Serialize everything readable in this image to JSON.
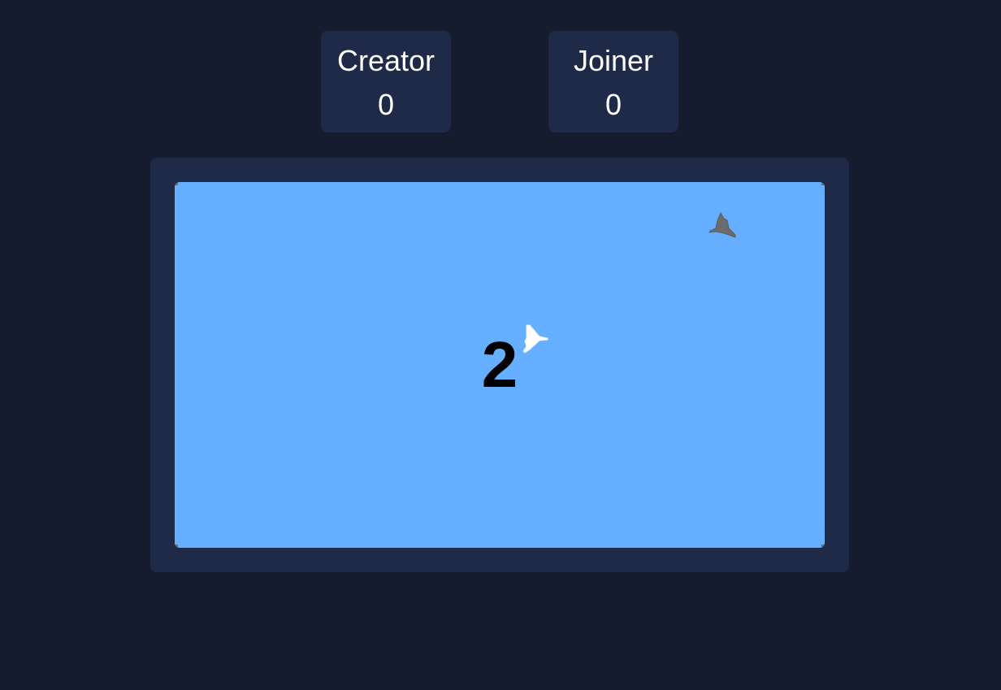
{
  "scoreboard": {
    "creator": {
      "label": "Creator",
      "score": "0"
    },
    "joiner": {
      "label": "Joiner",
      "score": "0"
    }
  },
  "arena": {
    "countdown": "2",
    "background_color": "#66aeff",
    "player_ship": {
      "icon": "jet-ship-icon",
      "color": "#ffffff"
    },
    "opponent_ship": {
      "icon": "jet-ship-icon",
      "color": "#6b6b6b"
    }
  },
  "colors": {
    "page_background": "#141c2e",
    "panel_background": "#1f2a48",
    "text": "#ffffff"
  }
}
